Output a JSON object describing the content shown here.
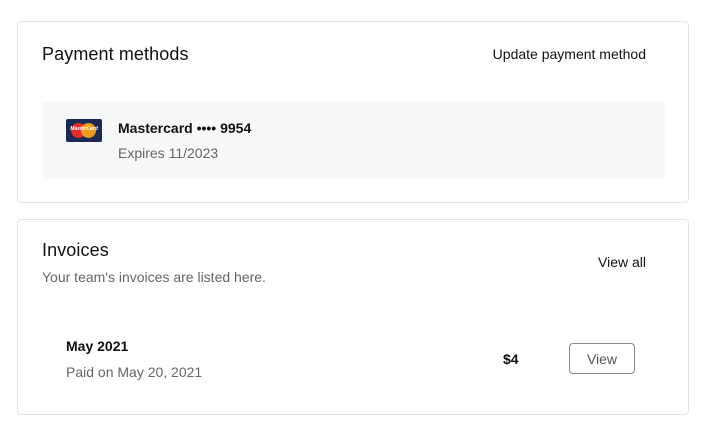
{
  "payment": {
    "title": "Payment methods",
    "update_label": "Update payment method",
    "method": {
      "brand_icon_text": "MasterCard",
      "name": "Mastercard •••• 9954",
      "expiry": "Expires 11/2023"
    }
  },
  "invoices": {
    "title": "Invoices",
    "view_all_label": "View all",
    "subtitle": "Your team's invoices are listed here.",
    "items": [
      {
        "period": "May 2021",
        "paid": "Paid on May 20, 2021",
        "amount": "$4",
        "view_label": "View"
      }
    ]
  },
  "colors": {
    "border": "#e3e4e6",
    "method_bg": "#f7f8fa",
    "muted_text": "#666666",
    "mastercard_red": "#e32d25",
    "mastercard_orange": "#f6a21c",
    "mastercard_bg": "#1b2a55"
  }
}
